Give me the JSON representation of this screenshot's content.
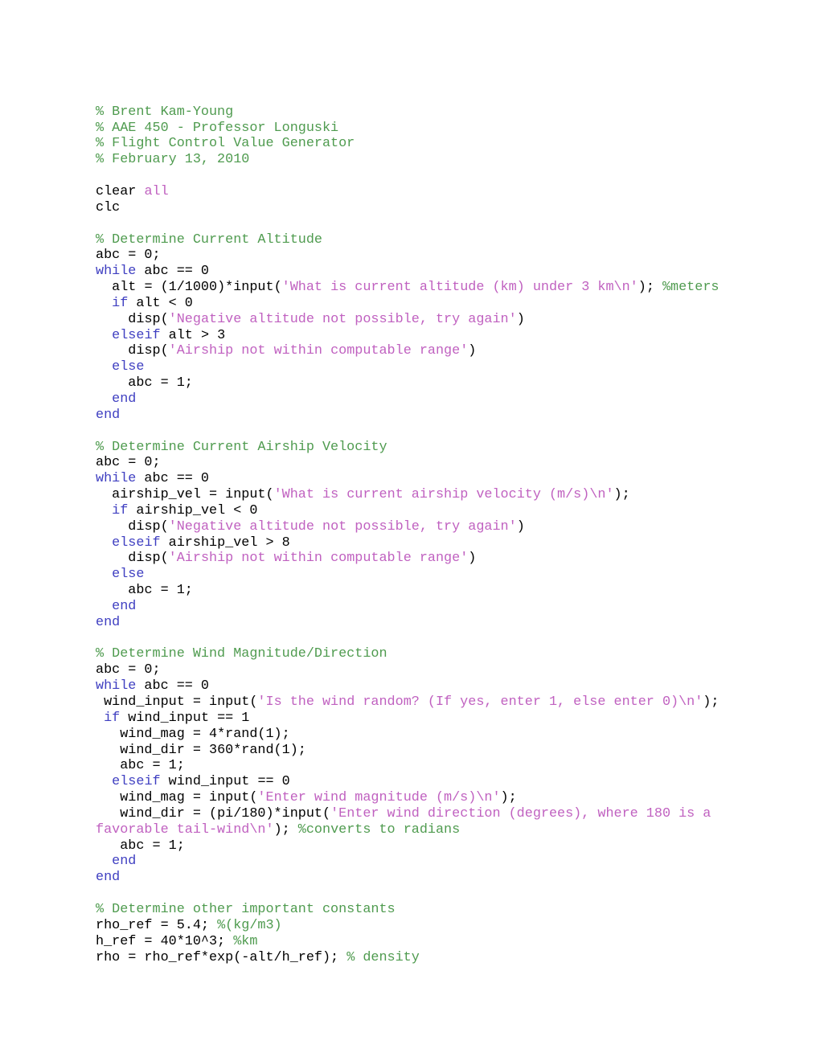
{
  "document": {
    "kind": "matlab-source-listing",
    "title": "Flight Control Value Generator",
    "author": "Brent Kam-Young",
    "course": "AAE 450 - Professor Longuski",
    "date": "February 13, 2010",
    "background_color": "#ffffff"
  },
  "syntax_colors": {
    "comment": "#4F9B4F",
    "string": "#C061C0",
    "keyword": "#3F3FC1",
    "plain": "#000000"
  },
  "lines": [
    {
      "id": "l1",
      "segments": [
        {
          "cls": "cmt",
          "t": "% Brent Kam-Young"
        }
      ]
    },
    {
      "id": "l2",
      "segments": [
        {
          "cls": "cmt",
          "t": "% AAE 450 - Professor Longuski"
        }
      ]
    },
    {
      "id": "l3",
      "segments": [
        {
          "cls": "cmt",
          "t": "% Flight Control Value Generator"
        }
      ]
    },
    {
      "id": "l4",
      "segments": [
        {
          "cls": "cmt",
          "t": "% February 13, 2010"
        }
      ]
    },
    {
      "id": "l5",
      "segments": []
    },
    {
      "id": "l6",
      "segments": [
        {
          "cls": "code",
          "t": "clear "
        },
        {
          "cls": "str",
          "t": "all"
        }
      ]
    },
    {
      "id": "l7",
      "segments": [
        {
          "cls": "code",
          "t": "clc"
        }
      ]
    },
    {
      "id": "l8",
      "segments": []
    },
    {
      "id": "l9",
      "segments": [
        {
          "cls": "cmt",
          "t": "% Determine Current Altitude"
        }
      ]
    },
    {
      "id": "l10",
      "segments": [
        {
          "cls": "code",
          "t": "abc = 0;"
        }
      ]
    },
    {
      "id": "l11",
      "segments": [
        {
          "cls": "kw",
          "t": "while"
        },
        {
          "cls": "code",
          "t": " abc == 0"
        }
      ]
    },
    {
      "id": "l12",
      "segments": [
        {
          "cls": "code",
          "t": "  alt = (1/1000)*input("
        },
        {
          "cls": "str",
          "t": "'What is current altitude (km) under 3 km\\n'"
        },
        {
          "cls": "code",
          "t": "); "
        },
        {
          "cls": "cmt",
          "t": "%meters"
        }
      ]
    },
    {
      "id": "l13",
      "segments": [
        {
          "cls": "code",
          "t": "  "
        },
        {
          "cls": "kw",
          "t": "if"
        },
        {
          "cls": "code",
          "t": " alt < 0"
        }
      ]
    },
    {
      "id": "l14",
      "segments": [
        {
          "cls": "code",
          "t": "    disp("
        },
        {
          "cls": "str",
          "t": "'Negative altitude not possible, try again'"
        },
        {
          "cls": "code",
          "t": ")"
        }
      ]
    },
    {
      "id": "l15",
      "segments": [
        {
          "cls": "code",
          "t": "  "
        },
        {
          "cls": "kw",
          "t": "elseif"
        },
        {
          "cls": "code",
          "t": " alt > 3"
        }
      ]
    },
    {
      "id": "l16",
      "segments": [
        {
          "cls": "code",
          "t": "    disp("
        },
        {
          "cls": "str",
          "t": "'Airship not within computable range'"
        },
        {
          "cls": "code",
          "t": ")"
        }
      ]
    },
    {
      "id": "l17",
      "segments": [
        {
          "cls": "code",
          "t": "  "
        },
        {
          "cls": "kw",
          "t": "else"
        }
      ]
    },
    {
      "id": "l18",
      "segments": [
        {
          "cls": "code",
          "t": "    abc = 1;"
        }
      ]
    },
    {
      "id": "l19",
      "segments": [
        {
          "cls": "code",
          "t": "  "
        },
        {
          "cls": "kw",
          "t": "end"
        }
      ]
    },
    {
      "id": "l20",
      "segments": [
        {
          "cls": "kw",
          "t": "end"
        }
      ]
    },
    {
      "id": "l21",
      "segments": []
    },
    {
      "id": "l22",
      "segments": [
        {
          "cls": "cmt",
          "t": "% Determine Current Airship Velocity"
        }
      ]
    },
    {
      "id": "l23",
      "segments": [
        {
          "cls": "code",
          "t": "abc = 0;"
        }
      ]
    },
    {
      "id": "l24",
      "segments": [
        {
          "cls": "kw",
          "t": "while"
        },
        {
          "cls": "code",
          "t": " abc == 0"
        }
      ]
    },
    {
      "id": "l25",
      "segments": [
        {
          "cls": "code",
          "t": "  airship_vel = input("
        },
        {
          "cls": "str",
          "t": "'What is current airship velocity (m/s)\\n'"
        },
        {
          "cls": "code",
          "t": ");"
        }
      ]
    },
    {
      "id": "l26",
      "segments": [
        {
          "cls": "code",
          "t": "  "
        },
        {
          "cls": "kw",
          "t": "if"
        },
        {
          "cls": "code",
          "t": " airship_vel < 0"
        }
      ]
    },
    {
      "id": "l27",
      "segments": [
        {
          "cls": "code",
          "t": "    disp("
        },
        {
          "cls": "str",
          "t": "'Negative altitude not possible, try again'"
        },
        {
          "cls": "code",
          "t": ")"
        }
      ]
    },
    {
      "id": "l28",
      "segments": [
        {
          "cls": "code",
          "t": "  "
        },
        {
          "cls": "kw",
          "t": "elseif"
        },
        {
          "cls": "code",
          "t": " airship_vel > 8"
        }
      ]
    },
    {
      "id": "l29",
      "segments": [
        {
          "cls": "code",
          "t": "    disp("
        },
        {
          "cls": "str",
          "t": "'Airship not within computable range'"
        },
        {
          "cls": "code",
          "t": ")"
        }
      ]
    },
    {
      "id": "l30",
      "segments": [
        {
          "cls": "code",
          "t": "  "
        },
        {
          "cls": "kw",
          "t": "else"
        }
      ]
    },
    {
      "id": "l31",
      "segments": [
        {
          "cls": "code",
          "t": "    abc = 1;"
        }
      ]
    },
    {
      "id": "l32",
      "segments": [
        {
          "cls": "code",
          "t": "  "
        },
        {
          "cls": "kw",
          "t": "end"
        }
      ]
    },
    {
      "id": "l33",
      "segments": [
        {
          "cls": "kw",
          "t": "end"
        }
      ]
    },
    {
      "id": "l34",
      "segments": []
    },
    {
      "id": "l35",
      "segments": [
        {
          "cls": "cmt",
          "t": "% Determine Wind Magnitude/Direction"
        }
      ]
    },
    {
      "id": "l36",
      "segments": [
        {
          "cls": "code",
          "t": "abc = 0;"
        }
      ]
    },
    {
      "id": "l37",
      "segments": [
        {
          "cls": "kw",
          "t": "while"
        },
        {
          "cls": "code",
          "t": " abc == 0"
        }
      ]
    },
    {
      "id": "l38",
      "segments": [
        {
          "cls": "code",
          "t": " wind_input = input("
        },
        {
          "cls": "str",
          "t": "'Is the wind random? (If yes, enter 1, else enter 0)\\n'"
        },
        {
          "cls": "code",
          "t": ");"
        }
      ]
    },
    {
      "id": "l39",
      "segments": [
        {
          "cls": "code",
          "t": " "
        },
        {
          "cls": "kw",
          "t": "if"
        },
        {
          "cls": "code",
          "t": " wind_input == 1"
        }
      ]
    },
    {
      "id": "l40",
      "segments": [
        {
          "cls": "code",
          "t": "   wind_mag = 4*rand(1);"
        }
      ]
    },
    {
      "id": "l41",
      "segments": [
        {
          "cls": "code",
          "t": "   wind_dir = 360*rand(1);"
        }
      ]
    },
    {
      "id": "l42",
      "segments": [
        {
          "cls": "code",
          "t": "   abc = 1;"
        }
      ]
    },
    {
      "id": "l43",
      "segments": [
        {
          "cls": "code",
          "t": "  "
        },
        {
          "cls": "kw",
          "t": "elseif"
        },
        {
          "cls": "code",
          "t": " wind_input == 0"
        }
      ]
    },
    {
      "id": "l44",
      "segments": [
        {
          "cls": "code",
          "t": "   wind_mag = input("
        },
        {
          "cls": "str",
          "t": "'Enter wind magnitude (m/s)\\n'"
        },
        {
          "cls": "code",
          "t": ");"
        }
      ]
    },
    {
      "id": "l45",
      "segments": [
        {
          "cls": "code",
          "t": "   wind_dir = (pi/180)*input("
        },
        {
          "cls": "str",
          "t": "'Enter wind direction (degrees), where 180 is a favorable tail-wind\\n'"
        },
        {
          "cls": "code",
          "t": "); "
        },
        {
          "cls": "cmt",
          "t": "%converts to radians"
        }
      ]
    },
    {
      "id": "l46",
      "segments": [
        {
          "cls": "code",
          "t": "   abc = 1;"
        }
      ]
    },
    {
      "id": "l47",
      "segments": [
        {
          "cls": "code",
          "t": "  "
        },
        {
          "cls": "kw",
          "t": "end"
        }
      ]
    },
    {
      "id": "l48",
      "segments": [
        {
          "cls": "kw",
          "t": "end"
        }
      ]
    },
    {
      "id": "l49",
      "segments": []
    },
    {
      "id": "l50",
      "segments": [
        {
          "cls": "cmt",
          "t": "% Determine other important constants"
        }
      ]
    },
    {
      "id": "l51",
      "segments": [
        {
          "cls": "code",
          "t": "rho_ref = 5.4; "
        },
        {
          "cls": "cmt",
          "t": "%(kg/m3)"
        }
      ]
    },
    {
      "id": "l52",
      "segments": [
        {
          "cls": "code",
          "t": "h_ref = 40*10^3; "
        },
        {
          "cls": "cmt",
          "t": "%km"
        }
      ]
    },
    {
      "id": "l53",
      "segments": [
        {
          "cls": "code",
          "t": "rho = rho_ref*exp(-alt/h_ref); "
        },
        {
          "cls": "cmt",
          "t": "% density"
        }
      ]
    }
  ]
}
